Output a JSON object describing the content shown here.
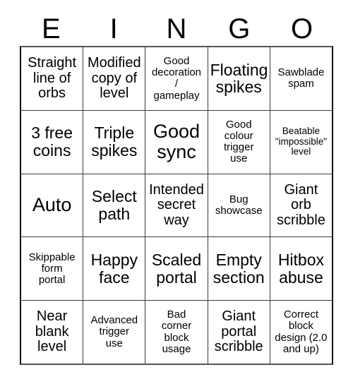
{
  "card": {
    "title_letters": [
      "E",
      "I",
      "N",
      "G",
      "O"
    ],
    "columns": 5,
    "rows": 5,
    "border_color": "#3a3a3a",
    "background_color": "#ffffff",
    "text_color": "#000000",
    "cells": [
      [
        {
          "text": "Straight\nline of\norbs",
          "size": "md"
        },
        {
          "text": "Modified\ncopy of\nlevel",
          "size": "md"
        },
        {
          "text": "Good\ndecoration\n/\ngameplay",
          "size": "sm"
        },
        {
          "text": "Floating\nspikes",
          "size": "lg"
        },
        {
          "text": "Sawblade\nspam",
          "size": "sm"
        }
      ],
      [
        {
          "text": "3 free\ncoins",
          "size": "lg"
        },
        {
          "text": "Triple\nspikes",
          "size": "lg"
        },
        {
          "text": "Good\nsync",
          "size": "xl"
        },
        {
          "text": "Good\ncolour\ntrigger\nuse",
          "size": "sm"
        },
        {
          "text": "Beatable\n\"impossible\"\nlevel",
          "size": "xs"
        }
      ],
      [
        {
          "text": "Auto",
          "size": "xl"
        },
        {
          "text": "Select\npath",
          "size": "lg"
        },
        {
          "text": "Intended\nsecret\nway",
          "size": "md"
        },
        {
          "text": "Bug\nshowcase",
          "size": "sm"
        },
        {
          "text": "Giant\norb\nscribble",
          "size": "md"
        }
      ],
      [
        {
          "text": "Skippable\nform\nportal",
          "size": "sm"
        },
        {
          "text": "Happy\nface",
          "size": "lg"
        },
        {
          "text": "Scaled\nportal",
          "size": "lg"
        },
        {
          "text": "Empty\nsection",
          "size": "lg"
        },
        {
          "text": "Hitbox\nabuse",
          "size": "lg"
        }
      ],
      [
        {
          "text": "Near\nblank\nlevel",
          "size": "md"
        },
        {
          "text": "Advanced\ntrigger\nuse",
          "size": "sm"
        },
        {
          "text": "Bad\ncorner\nblock\nusage",
          "size": "sm"
        },
        {
          "text": "Giant\nportal\nscribble",
          "size": "md"
        },
        {
          "text": "Correct\nblock\ndesign (2.0\nand up)",
          "size": "sm"
        }
      ]
    ]
  }
}
